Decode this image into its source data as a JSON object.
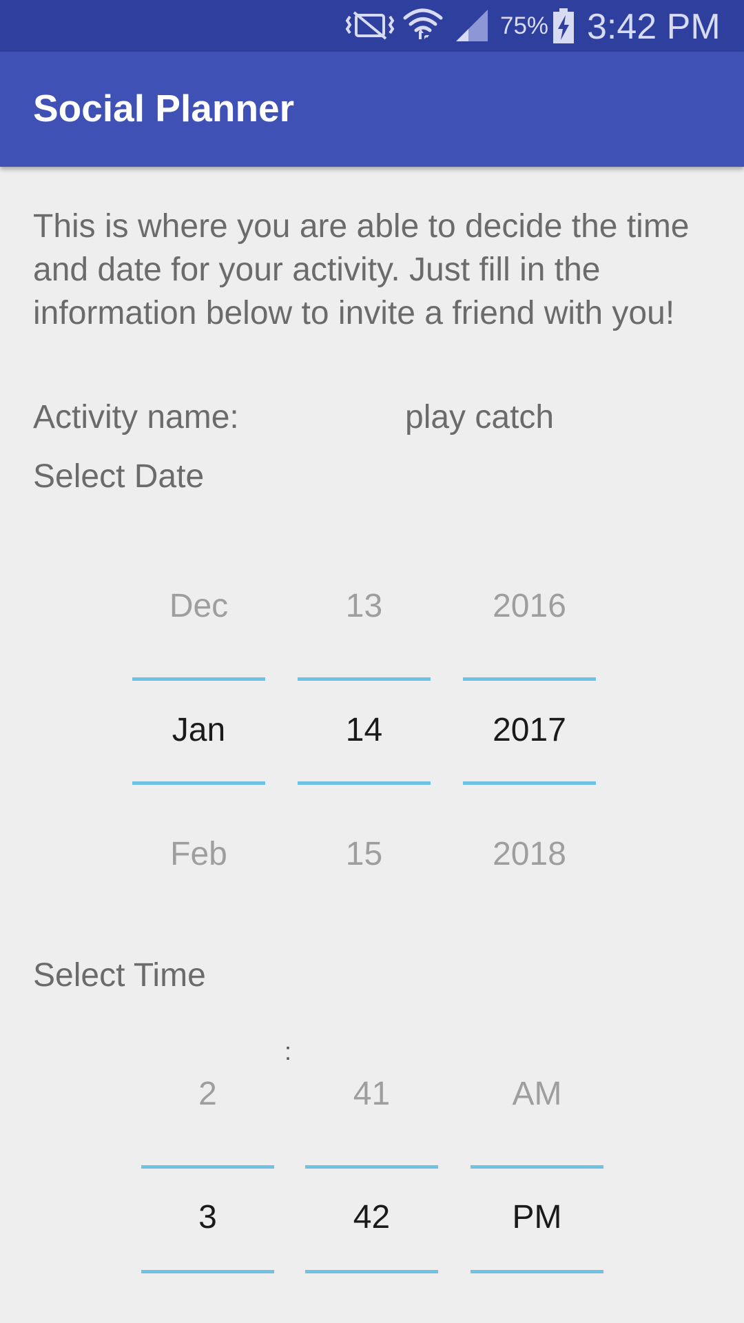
{
  "status_bar": {
    "battery_percent": "75%",
    "time": "3:42 PM",
    "icons": [
      "vibrate-icon",
      "wifi-icon",
      "signal-icon",
      "battery-charging-icon"
    ]
  },
  "app_bar": {
    "title": "Social Planner"
  },
  "description": "This is where you are able to decide the time and date for your activity. Just fill in the information below to invite a friend with you!",
  "activity": {
    "label": "Activity name:",
    "value": "play catch"
  },
  "date_section": {
    "label": "Select Date",
    "month": {
      "prev": "Dec",
      "current": "Jan",
      "next": "Feb"
    },
    "day": {
      "prev": "13",
      "current": "14",
      "next": "15"
    },
    "year": {
      "prev": "2016",
      "current": "2017",
      "next": "2018"
    }
  },
  "time_section": {
    "label": "Select Time",
    "hour": {
      "prev": "2",
      "current": "3"
    },
    "separator": ":",
    "minute": {
      "prev": "41",
      "current": "42"
    },
    "ampm": {
      "prev": "AM",
      "current": "PM"
    }
  },
  "colors": {
    "status_bar": "#2f3f9e",
    "app_bar": "#3f51b5",
    "picker_divider": "#6fc2e4",
    "background": "#eeeeef"
  }
}
